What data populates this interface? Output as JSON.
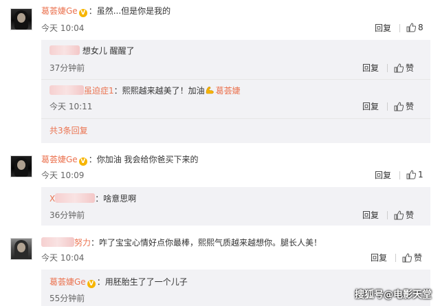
{
  "comments": [
    {
      "user": "葛荟婕Ge",
      "verified_badge": "V",
      "text": "：虽然...但是你是我的",
      "time": "今天 10:04",
      "reply_label": "回复",
      "like_count": "8",
      "replies": [
        {
          "user": "",
          "text": "想女儿 醒醒了",
          "time": "37分钟前",
          "reply_label": "回复",
          "like_label": "赞"
        },
        {
          "user": "虽迫症1",
          "text": "：熙熙越来越美了！加油",
          "mention": "葛荟婕",
          "time": "今天 10:11",
          "reply_label": "回复",
          "like_label": "赞"
        }
      ],
      "more_replies": "共3条回复"
    },
    {
      "user": "葛荟婕Ge",
      "verified_badge": "V",
      "text": "：你加油 我会给你爸买下来的",
      "time": "今天 10:09",
      "reply_label": "回复",
      "like_count": "1",
      "replies": [
        {
          "user": "X",
          "text": "：啥意思啊",
          "time": "36分钟前",
          "reply_label": "回复",
          "like_label": "赞"
        }
      ]
    },
    {
      "user": "努力",
      "text": "：咋了宝宝心情好点你最棒，熙熙气质越来越想你。腿长人美！",
      "time": "今天 10:04",
      "reply_label": "回复",
      "like_label": "赞",
      "replies": [
        {
          "user": "葛荟婕Ge",
          "verified_badge": "V",
          "text": "：用胚胎生了了一个儿子",
          "time": "55分钟前"
        }
      ]
    }
  ],
  "watermark": "搜狐号@电影天堂",
  "colors": {
    "name": "#eb7350",
    "badge": "#f7b500",
    "reply_bg": "#f2f2f5",
    "meta": "#666666"
  }
}
